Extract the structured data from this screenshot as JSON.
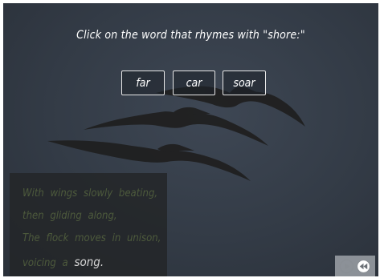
{
  "prompt": {
    "text": "Click on the word that rhymes with \"shore:\""
  },
  "choices": [
    {
      "label": "far"
    },
    {
      "label": "car"
    },
    {
      "label": "soar"
    }
  ],
  "poem": {
    "line1": "With wings slowly beating,",
    "line2": "then gliding along,",
    "line3": "The flock moves in unison,",
    "line4_prefix": "voicing a",
    "line4_highlight": "song."
  },
  "nav": {
    "play_icon": "play-icon",
    "rewind_icon": "rewind-icon"
  },
  "colors": {
    "background": "#333b46",
    "poem_text": "#4d5a3c",
    "highlight": "#d8d8d8",
    "button_border": "#e8e8e8"
  }
}
